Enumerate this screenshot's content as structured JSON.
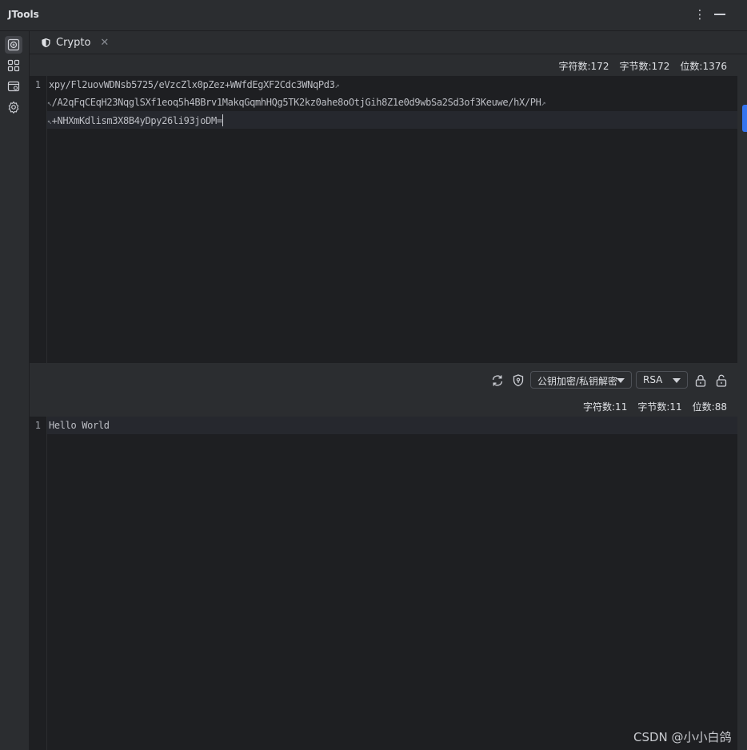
{
  "app": {
    "title": "JTools"
  },
  "window": {
    "more_icon": "more-vertical-icon",
    "minimize_icon": "minimize-icon"
  },
  "sidebar": {
    "items": [
      {
        "icon": "crypto-tool-icon",
        "active": true
      },
      {
        "icon": "apps-grid-icon",
        "active": false
      },
      {
        "icon": "window-tool-icon",
        "active": false
      },
      {
        "icon": "settings-icon",
        "active": false
      }
    ]
  },
  "tab": {
    "label": "Crypto",
    "icon": "shield-icon",
    "close": "✕"
  },
  "input_stats": {
    "chars": "字符数:172",
    "bytes": "字节数:172",
    "bits": "位数:1376"
  },
  "input_editor": {
    "line_number": "1",
    "lines": [
      "xpy/Fl2uovWDNsb5725/eVzcZlx0pZez+WWfdEgXF2Cdc3WNqPd3",
      "/A2qFqCEqH23NqglSXf1eoq5h4BBrv1MakqGqmhHQg5TK2kz0ahe8oOtjGih8Z1e0d9wbSa2Sd3of3Keuwe/hX/PH",
      "+NHXmKdlism3X8B4yDpy26li93joDM="
    ]
  },
  "toolbar": {
    "refresh_icon": "refresh-icon",
    "shield_icon": "shield-key-icon",
    "mode_select": "公钥加密/私钥解密",
    "algorithm_select": "RSA",
    "encrypt_icon": "lock-icon",
    "decrypt_icon": "unlock-icon"
  },
  "output_stats": {
    "chars": "字符数:11",
    "bytes": "字节数:11",
    "bits": "位数:88"
  },
  "output_editor": {
    "line_number": "1",
    "text": "Hello World"
  },
  "watermark": "CSDN @小小白鸽",
  "colors": {
    "background": "#2b2d30",
    "editor": "#1e1f22",
    "accent": "#3574f0"
  }
}
